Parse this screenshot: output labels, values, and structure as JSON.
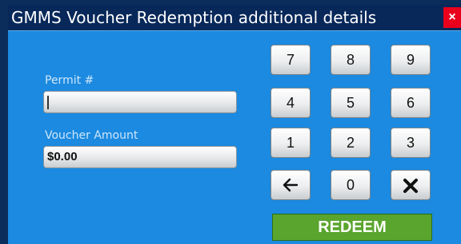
{
  "dialog": {
    "title": "GMMS Voucher Redemption additional details",
    "close_label": "×"
  },
  "form": {
    "permit_label": "Permit #",
    "permit_value": "",
    "amount_label": "Voucher Amount",
    "amount_value": "$0.00"
  },
  "keypad": {
    "k7": "7",
    "k8": "8",
    "k9": "9",
    "k4": "4",
    "k5": "5",
    "k6": "6",
    "k1": "1",
    "k2": "2",
    "k3": "3",
    "k0": "0",
    "backspace_icon": "left-arrow-icon",
    "clear_icon": "x-icon"
  },
  "actions": {
    "redeem_label": "REDEEM",
    "redeem_color": "#5aa52e"
  }
}
